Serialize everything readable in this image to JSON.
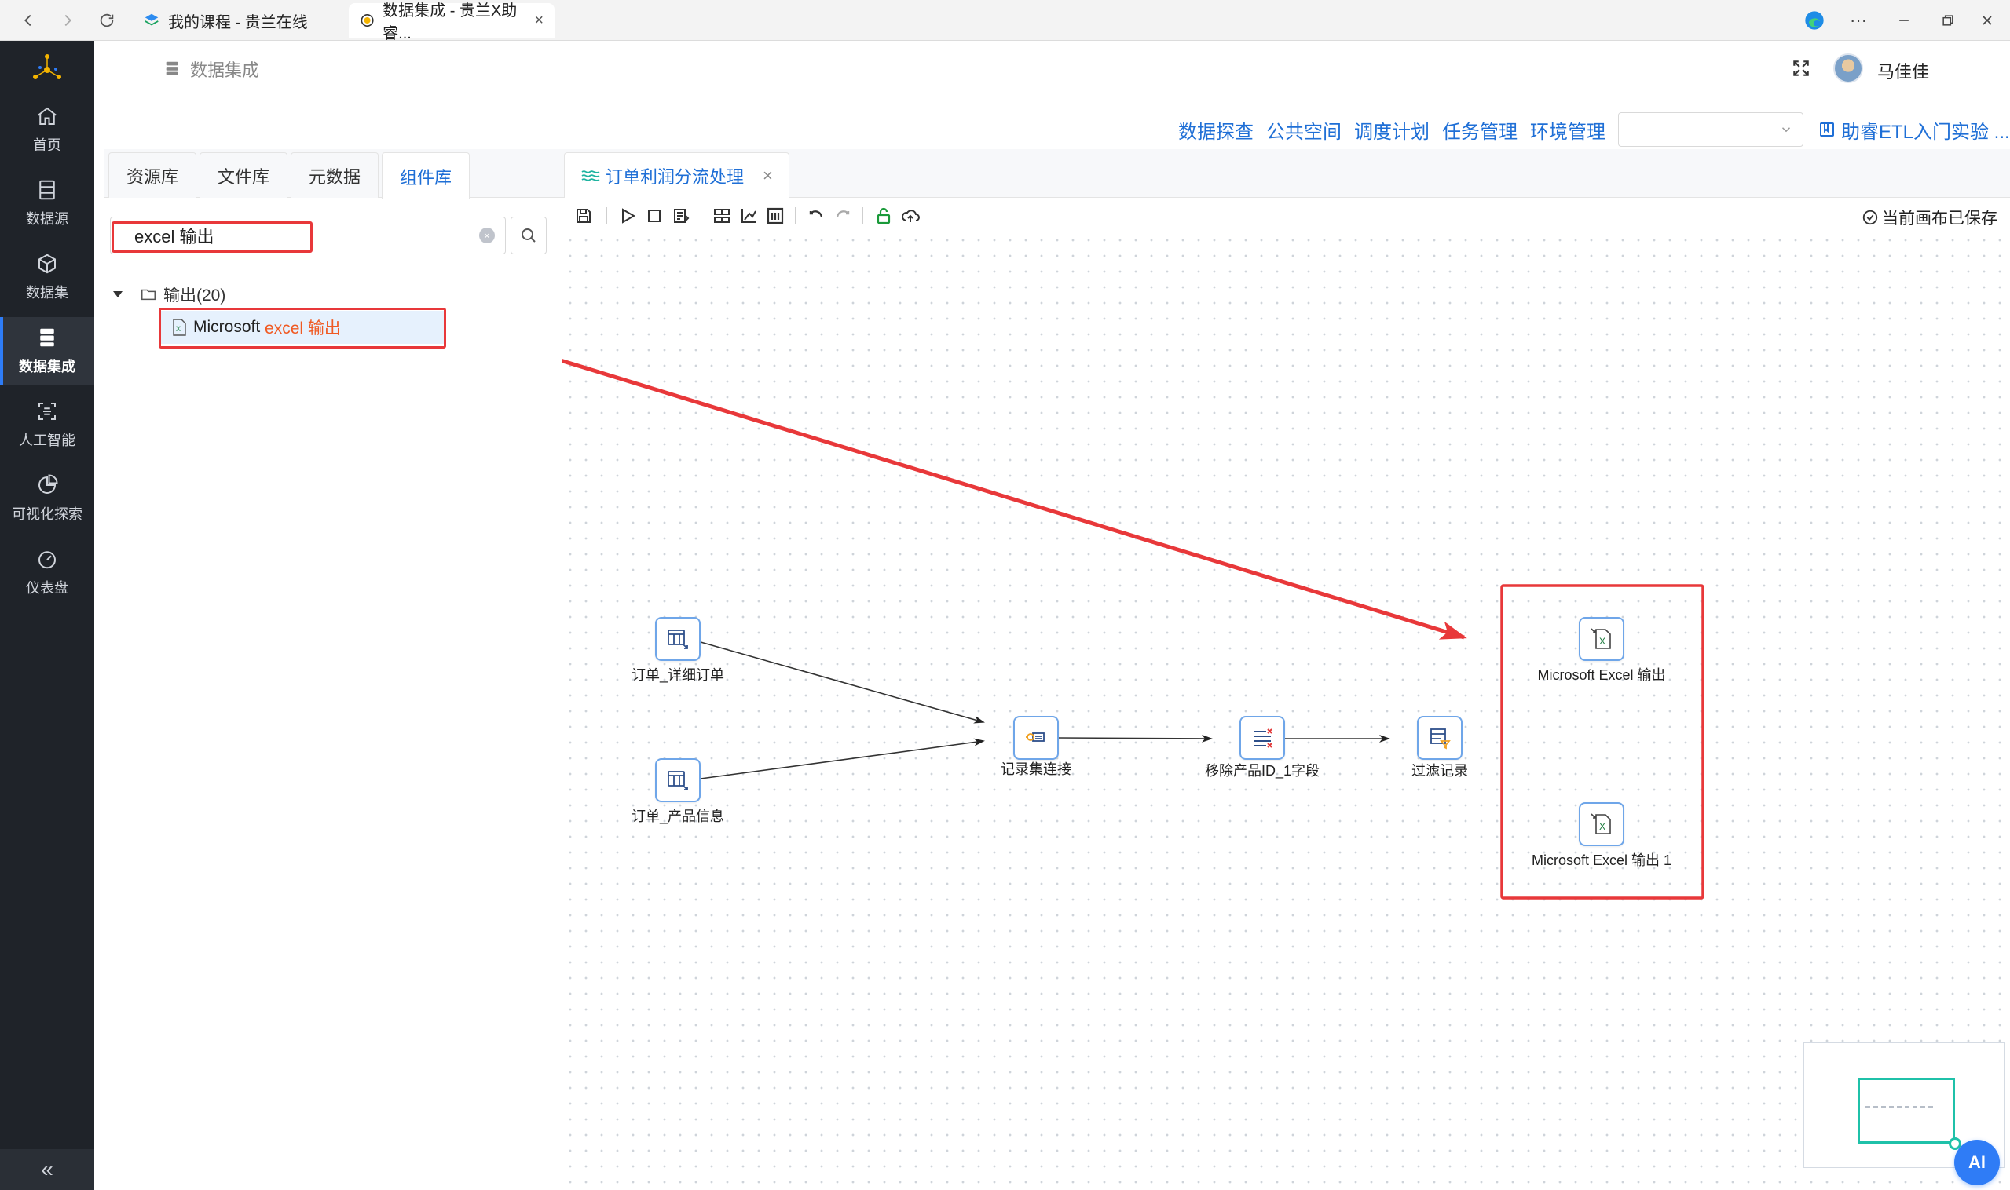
{
  "browser": {
    "tabs": [
      {
        "title": "我的课程 - 贵兰在线",
        "active": false
      },
      {
        "title": "数据集成 - 贵兰X助睿...",
        "active": true
      }
    ],
    "close_symbol": "×",
    "more_symbol": "···"
  },
  "sidebar": {
    "items": [
      {
        "label": "首页",
        "icon": "home-icon"
      },
      {
        "label": "数据源",
        "icon": "database-icon"
      },
      {
        "label": "数据集",
        "icon": "cube-icon"
      },
      {
        "label": "数据集成",
        "icon": "server-icon",
        "active": true
      },
      {
        "label": "人工智能",
        "icon": "ai-scan-icon"
      },
      {
        "label": "可视化探索",
        "icon": "pie-chart-icon"
      },
      {
        "label": "仪表盘",
        "icon": "gauge-icon"
      }
    ],
    "collapse_symbol": "«"
  },
  "header": {
    "title": "数据集成",
    "username": "马佳佳"
  },
  "top_menu": {
    "links": [
      "数据探查",
      "公共空间",
      "调度计划",
      "任务管理",
      "环境管理"
    ],
    "select_value": "",
    "guide_label": "助睿ETL入门实验 ..."
  },
  "left_panel": {
    "tabs": [
      {
        "label": "资源库",
        "active": false
      },
      {
        "label": "文件库",
        "active": false
      },
      {
        "label": "元数据",
        "active": false
      },
      {
        "label": "组件库",
        "active": true
      }
    ],
    "search_value": "excel 输出",
    "tree": {
      "folder_label": "输出(20)",
      "item_prefix": "Microsoft ",
      "item_highlight": "excel 输出"
    }
  },
  "editor": {
    "tab_label": "订单利润分流处理",
    "saved_status": "当前画布已保存",
    "ai_label": "AI"
  },
  "canvas": {
    "nodes": [
      {
        "id": "n1",
        "label": "订单_详细订单",
        "icon": "table-input-icon"
      },
      {
        "id": "n2",
        "label": "订单_产品信息",
        "icon": "table-input-icon"
      },
      {
        "id": "n3",
        "label": "记录集连接",
        "icon": "join-icon"
      },
      {
        "id": "n4",
        "label": "移除产品ID_1字段",
        "icon": "remove-field-icon"
      },
      {
        "id": "n5",
        "label": "过滤记录",
        "icon": "filter-icon"
      },
      {
        "id": "n6",
        "label": "Microsoft Excel 输出",
        "icon": "excel-output-icon"
      },
      {
        "id": "n7",
        "label": "Microsoft Excel 输出 1",
        "icon": "excel-output-icon"
      }
    ],
    "edges": [
      [
        "n1",
        "n3"
      ],
      [
        "n2",
        "n3"
      ],
      [
        "n3",
        "n4"
      ],
      [
        "n4",
        "n5"
      ]
    ]
  },
  "colors": {
    "accent": "#1f6fd6",
    "annotation": "#e8383a",
    "highlight_text": "#f05a23",
    "sidebar_bg": "#1f2329"
  }
}
